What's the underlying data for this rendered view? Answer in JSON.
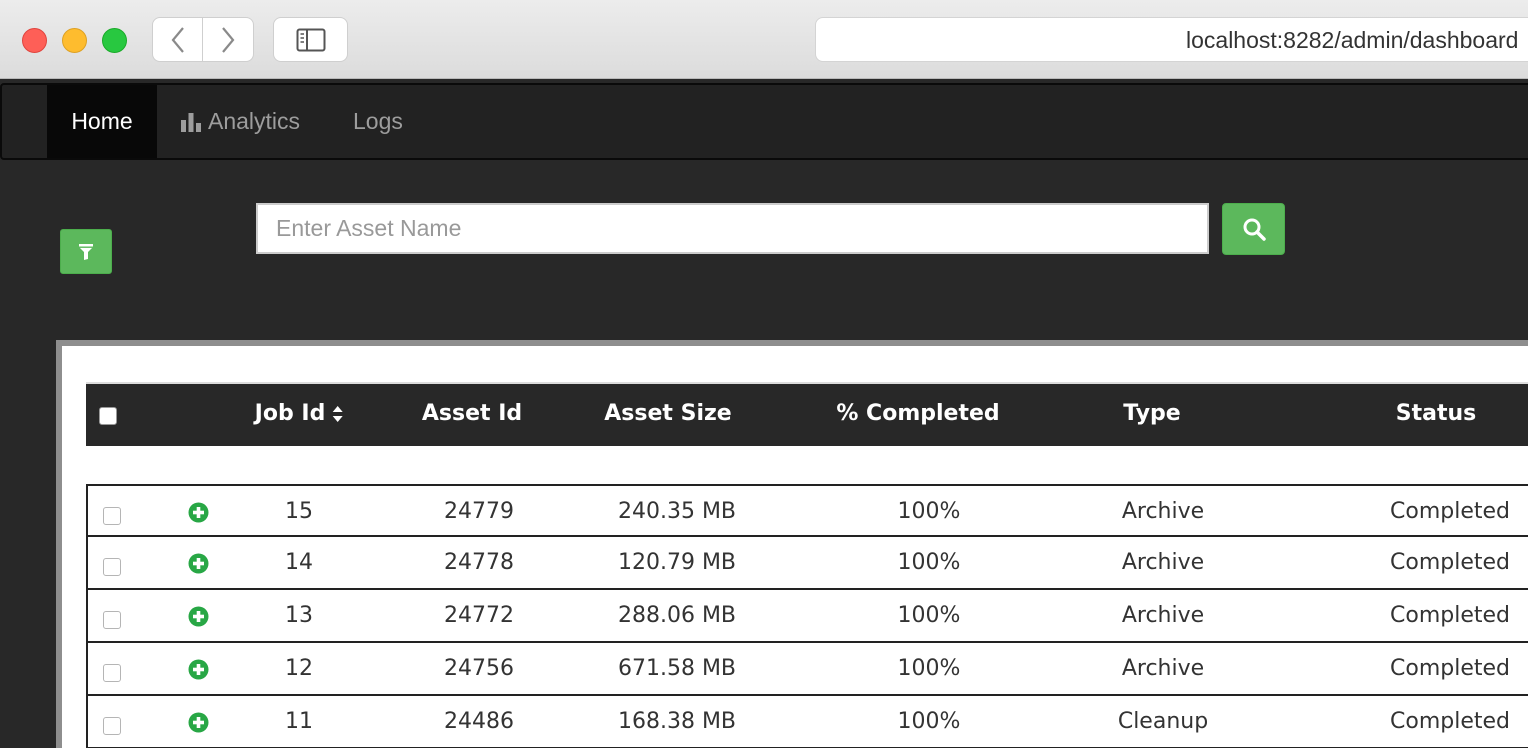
{
  "browser": {
    "url": "localhost:8282/admin/dashboard"
  },
  "nav": {
    "items": [
      {
        "label": "Home",
        "active": true
      },
      {
        "label": "Analytics",
        "icon": "bar-chart-icon"
      },
      {
        "label": "Logs"
      }
    ]
  },
  "search": {
    "placeholder": "Enter Asset Name",
    "button_icon": "search-icon",
    "filter_icon": "filter-icon"
  },
  "colors": {
    "accent_green": "#5cb85c",
    "nav_bg": "#222222",
    "page_bg": "#282828"
  },
  "table": {
    "columns": [
      "Job Id",
      "Asset Id",
      "Asset Size",
      "% Completed",
      "Type",
      "Status"
    ],
    "sortable_column": "Job Id",
    "rows": [
      {
        "job_id": "15",
        "asset_id": "24779",
        "asset_size": "240.35 MB",
        "completed": "100%",
        "type": "Archive",
        "status": "Completed"
      },
      {
        "job_id": "14",
        "asset_id": "24778",
        "asset_size": "120.79 MB",
        "completed": "100%",
        "type": "Archive",
        "status": "Completed"
      },
      {
        "job_id": "13",
        "asset_id": "24772",
        "asset_size": "288.06 MB",
        "completed": "100%",
        "type": "Archive",
        "status": "Completed"
      },
      {
        "job_id": "12",
        "asset_id": "24756",
        "asset_size": "671.58 MB",
        "completed": "100%",
        "type": "Archive",
        "status": "Completed"
      },
      {
        "job_id": "11",
        "asset_id": "24486",
        "asset_size": "168.38 MB",
        "completed": "100%",
        "type": "Cleanup",
        "status": "Completed"
      }
    ]
  }
}
